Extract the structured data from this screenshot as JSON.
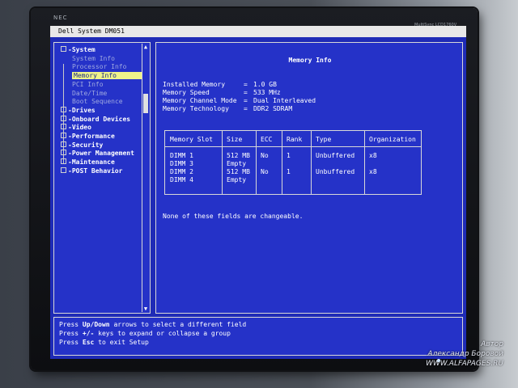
{
  "window": {
    "title": "Dell System DM051"
  },
  "monitor": {
    "brand": "NEC",
    "model": "MultiSync LCD1760V"
  },
  "tree": {
    "items": [
      {
        "label": "System",
        "kind": "group",
        "expanded": true
      },
      {
        "label": "System Info",
        "kind": "child"
      },
      {
        "label": "Processor Info",
        "kind": "child"
      },
      {
        "label": "Memory Info",
        "kind": "child",
        "selected": true
      },
      {
        "label": "PCI Info",
        "kind": "child"
      },
      {
        "label": "Date/Time",
        "kind": "child"
      },
      {
        "label": "Boot Sequence",
        "kind": "child"
      },
      {
        "label": "Drives",
        "kind": "group"
      },
      {
        "label": "Onboard Devices",
        "kind": "group"
      },
      {
        "label": "Video",
        "kind": "group"
      },
      {
        "label": "Performance",
        "kind": "group"
      },
      {
        "label": "Security",
        "kind": "group"
      },
      {
        "label": "Power Management",
        "kind": "group"
      },
      {
        "label": "Maintenance",
        "kind": "group"
      },
      {
        "label": "POST Behavior",
        "kind": "group"
      }
    ]
  },
  "main": {
    "title": "Memory Info",
    "fields": [
      {
        "label": "Installed Memory",
        "value": "1.0 GB"
      },
      {
        "label": "Memory Speed",
        "value": "533 MHz"
      },
      {
        "label": "Memory Channel Mode",
        "value": "Dual Interleaved"
      },
      {
        "label": "Memory Technology",
        "value": "DDR2 SDRAM"
      }
    ],
    "table": {
      "headers": [
        "Memory Slot",
        "Size",
        "ECC",
        "Rank",
        "Type",
        "Organization"
      ],
      "rows": [
        [
          "DIMM 1",
          "512 MB",
          "No",
          "1",
          "Unbuffered",
          "x8"
        ],
        [
          "DIMM 3",
          "Empty",
          "",
          "",
          "",
          ""
        ],
        [
          "DIMM 2",
          "512 MB",
          "No",
          "1",
          "Unbuffered",
          "x8"
        ],
        [
          "DIMM 4",
          "Empty",
          "",
          "",
          "",
          ""
        ]
      ]
    },
    "note": "None of these fields are changeable."
  },
  "help": {
    "lines": [
      {
        "pre": "Press ",
        "key": "Up/Down",
        "post": " arrows to select a different field"
      },
      {
        "pre": "Press ",
        "key": "+/-",
        "post": " keys to expand or collapse a group"
      },
      {
        "pre": "Press ",
        "key": "Esc",
        "post": " to exit Setup"
      }
    ]
  },
  "watermark": {
    "line1": "Автор",
    "line2": "Александр Боровой",
    "line3": "WWW.ALFAPAGES.RU"
  }
}
